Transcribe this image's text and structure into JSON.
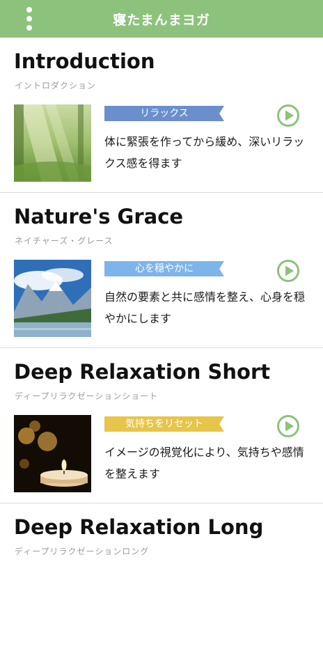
{
  "app": {
    "title": "寝たまんまヨガ"
  },
  "colors": {
    "header": "#8dc27c",
    "play_icon": "#8dc27c"
  },
  "lessons": [
    {
      "title": "Introduction",
      "subtitle": "イントロダクション",
      "tag": "リラックス",
      "tag_color": "blue",
      "description": "体に緊張を作ってから緩め、深いリラックス感を得ます",
      "thumbnail": "forest-sunlight-image"
    },
    {
      "title": "Nature's Grace",
      "subtitle": "ネイチャーズ・グレース",
      "tag": "心を穏やかに",
      "tag_color": "lightblue",
      "description": "自然の要素と共に感情を整え、心身を穏やかにします",
      "thumbnail": "mountain-lake-image"
    },
    {
      "title": "Deep Relaxation Short",
      "subtitle": "ディープリラクゼーションショート",
      "tag": "気持ちをリセット",
      "tag_color": "yellow",
      "description": "イメージの視覚化により、気持ちや感情を整えます",
      "thumbnail": "candle-image"
    },
    {
      "title": "Deep Relaxation Long",
      "subtitle": "ディープリラクゼーションロング"
    }
  ]
}
